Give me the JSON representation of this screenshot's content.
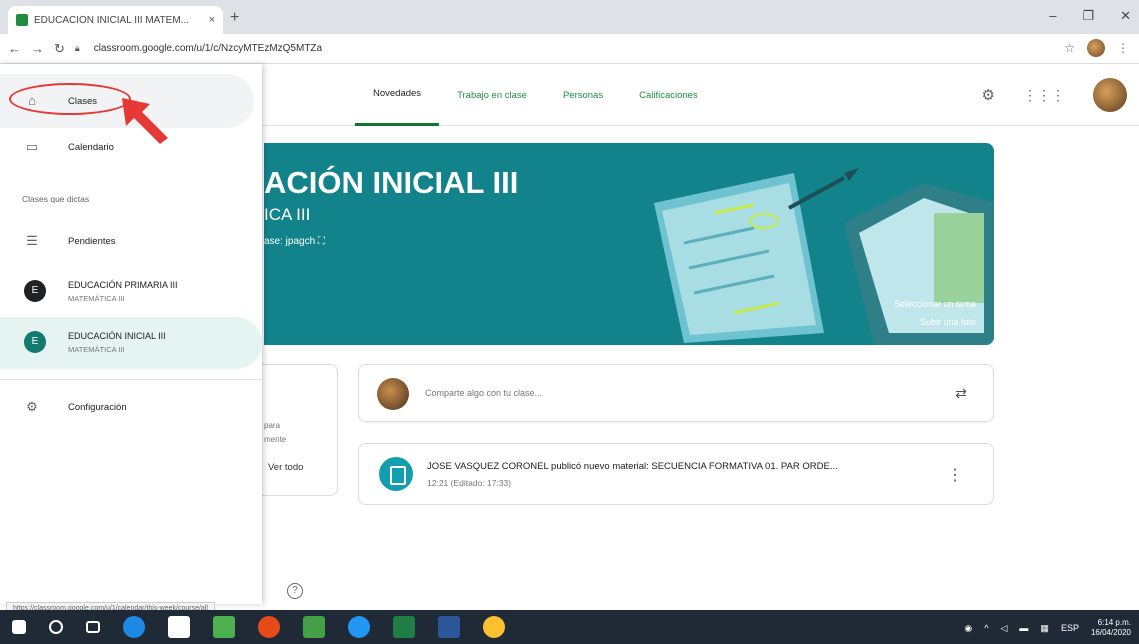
{
  "browser": {
    "tab_title": "EDUCACIÓN INICIAL III MATEM...",
    "tab_close": "×",
    "new_tab": "+",
    "url": "classroom.google.com/u/1/c/NzcyMTEzMzQ5MTZa",
    "status_url": "https://classroom.google.com/u/1/calendar/this-week/course/all"
  },
  "classroom_tabs": [
    "Novedades",
    "Trabajo en clase",
    "Personas",
    "Calificaciones"
  ],
  "banner": {
    "title": "ACIÓN INICIAL III",
    "subtitle": "ICA III",
    "code": "ase: jpagch ⛶",
    "theme_link": "Seleccionar un tema",
    "photo_link": "Subir una foto",
    "color": "#12828b"
  },
  "upcoming": {
    "frag1": "para",
    "frag2": "mente",
    "view_all": "Ver todo"
  },
  "share": {
    "placeholder": "Comparte algo con tu clase..."
  },
  "post": {
    "title": "JOSE VASQUEZ CORONEL publicó nuevo material: SECUENCIA FORMATIVA 01. PAR ORDE...",
    "date": "12:21 (Editado: 17:33)"
  },
  "drawer": {
    "classes": "Clases",
    "calendar": "Calendario",
    "section": "Clases que dictas",
    "pending": "Pendientes",
    "class_list": [
      {
        "initial": "E",
        "name": "EDUCACIÓN PRIMARIA III",
        "subject": "MATEMÁTICA III"
      },
      {
        "initial": "E",
        "name": "EDUCACIÓN INICIAL III",
        "subject": "MATEMÁTICA III"
      }
    ],
    "settings": "Configuración"
  },
  "taskbar": {
    "lang": "ESP",
    "time": "6:14 p.m.",
    "date": "16/04/2020"
  }
}
